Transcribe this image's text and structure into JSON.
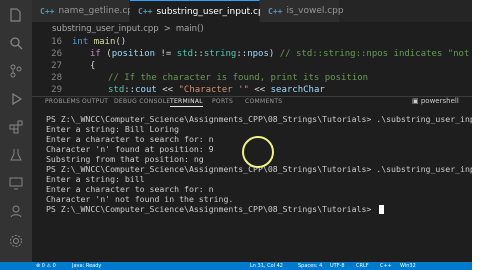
{
  "tabs": [
    {
      "icon": "C++",
      "label": "name_getline.cpp"
    },
    {
      "icon": "C++",
      "label": "substring_user_input.cpp",
      "close": "×"
    },
    {
      "icon": "C++",
      "label": "is_vowel.cpp"
    }
  ],
  "breadcrumb": [
    "substring_user_input.cpp",
    ">",
    "main()"
  ],
  "editor_lines": [
    {
      "num": "16",
      "tokens": [
        [
          "int ",
          "kw"
        ],
        [
          "main",
          "fn"
        ],
        [
          "()",
          "pl"
        ]
      ]
    },
    {
      "num": "26",
      "tokens": [
        [
          "if ",
          "kw2"
        ],
        [
          "(",
          "pl"
        ],
        [
          "position",
          "var"
        ],
        [
          " != ",
          "pl"
        ],
        [
          "std",
          "ty"
        ],
        [
          "::",
          "pl"
        ],
        [
          "string",
          "ty"
        ],
        [
          "::",
          "pl"
        ],
        [
          "npos",
          "var"
        ],
        [
          ") ",
          "pl"
        ],
        [
          "// std::string::npos indicates \"not found\"",
          "cm"
        ]
      ]
    },
    {
      "num": "27",
      "tokens": [
        [
          "{",
          "pl"
        ]
      ]
    },
    {
      "num": "28",
      "tokens": [
        [
          "// If the character is found, print its position",
          "cm"
        ]
      ]
    },
    {
      "num": "29",
      "tokens": [
        [
          "std",
          "ty"
        ],
        [
          "::",
          "pl"
        ],
        [
          "cout",
          "var"
        ],
        [
          " << ",
          "pl"
        ],
        [
          "\"Character '\"",
          "str"
        ],
        [
          " << ",
          "pl"
        ],
        [
          "searchChar",
          "var"
        ]
      ]
    }
  ],
  "panel": {
    "tabs": [
      "PROBLEMS",
      "OUTPUT",
      "DEBUG CONSOLE",
      "TERMINAL",
      "PORTS",
      "COMMENTS"
    ],
    "active": "TERMINAL",
    "shell": "powershell"
  },
  "terminal_lines": [
    "PS Z:\\_WNCC\\Computer_Science\\Assignments_CPP\\08_Strings\\Tutorials> .\\substring_user_input.exe",
    "Enter a string: Bill Loring",
    "Enter a character to search for: n",
    "Character 'n' found at position: 9",
    "Substring from that position: ng",
    "PS Z:\\_WNCC\\Computer_Science\\Assignments_CPP\\08_Strings\\Tutorials> .\\substring_user_input.exe",
    "Enter a string: bill",
    "Enter a character to search for: n",
    "Character 'n' not found in the string.",
    "PS Z:\\_WNCC\\Computer_Science\\Assignments_CPP\\08_Strings\\Tutorials> "
  ],
  "status": {
    "left": "⊗ 0 ⚠ 0",
    "mode": "Java: Ready",
    "position": "Ln 31, Col 42",
    "spaces": "Spaces: 4",
    "encoding": "UTF-8",
    "eol": "CRLF",
    "lang": "C++",
    "platform": "Win32"
  },
  "colors": {
    "accent": "#007acc",
    "bg": "#1e1e1e",
    "highlight": "#f0f08a"
  }
}
